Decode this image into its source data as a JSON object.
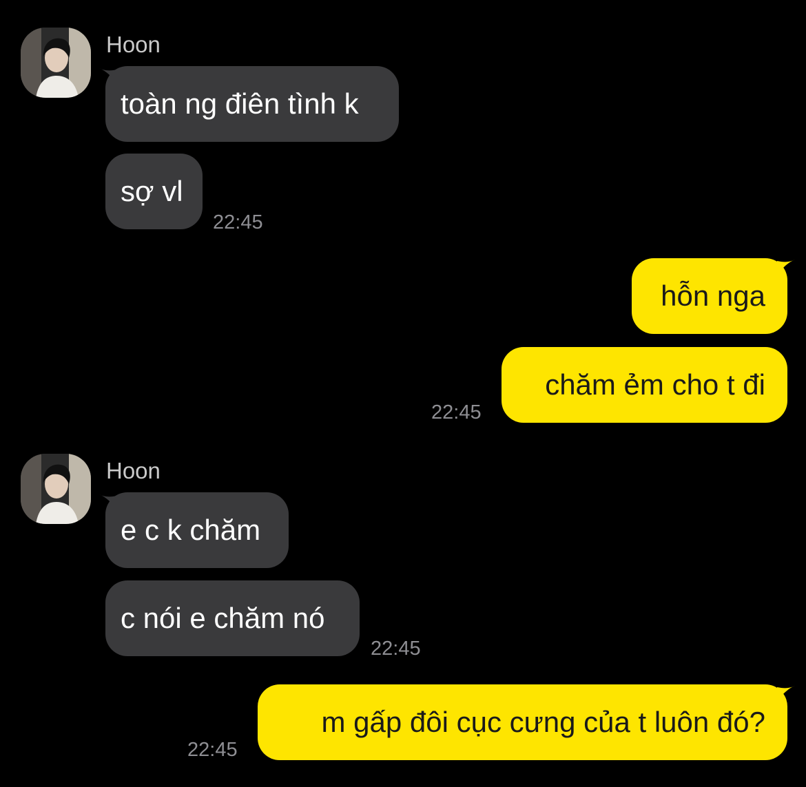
{
  "colors": {
    "background": "#000000",
    "incoming_bubble": "#3a3a3c",
    "outgoing_bubble": "#fee500",
    "timestamp": "#8e8e93",
    "sender_name": "#c9c9c9"
  },
  "groups": [
    {
      "direction": "incoming",
      "sender": "Hoon",
      "avatar_icon": "profile-photo-icon",
      "messages": [
        "toàn ng điên tình k",
        "sợ vl"
      ],
      "time": "22:45"
    },
    {
      "direction": "outgoing",
      "messages": [
        "hỗn nga",
        "chăm ẻm cho t đi"
      ],
      "time": "22:45"
    },
    {
      "direction": "incoming",
      "sender": "Hoon",
      "avatar_icon": "profile-photo-icon",
      "messages": [
        "e c k chăm",
        "c nói e chăm nó"
      ],
      "time": "22:45"
    },
    {
      "direction": "outgoing",
      "messages": [
        "m gấp đôi cục cưng của t luôn đó?"
      ],
      "time": "22:45"
    }
  ]
}
